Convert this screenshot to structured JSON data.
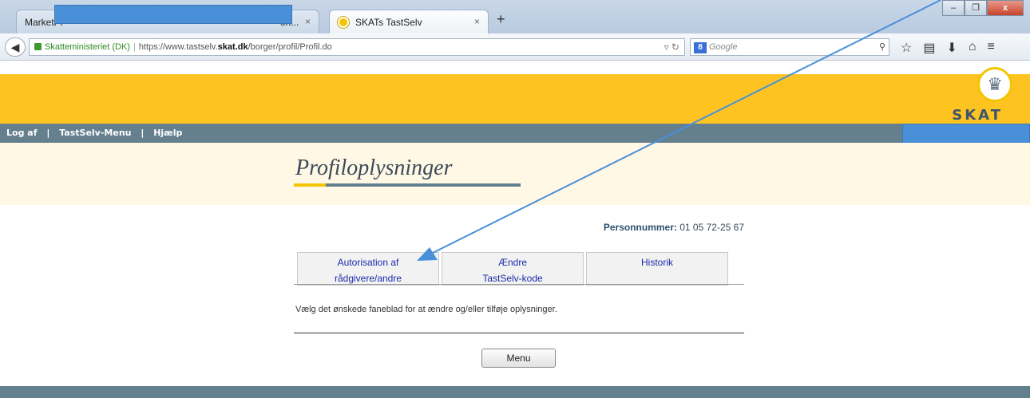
{
  "browser": {
    "tabs": [
      {
        "title_start": "MarketPr",
        "title_end": "on..."
      },
      {
        "title": "SKATs TastSelv"
      }
    ],
    "close_glyph": "×",
    "new_tab_glyph": "+",
    "window_buttons": [
      "–",
      "❐",
      "x"
    ],
    "address": {
      "org": "Skatteministeriet (DK)",
      "url_prefix": "https://www.tastselv.",
      "url_domain": "skat.dk",
      "url_path": "/borger/profil/Profil.do"
    },
    "search_placeholder": "Google",
    "search_engine_glyph": "8"
  },
  "site": {
    "brand": "SKAT",
    "nav": [
      "Log af",
      "TastSelv-Menu",
      "Hjælp"
    ],
    "nav_separator": "|",
    "page_title": "Profiloplysninger",
    "cpr_label": "Personnummer:",
    "cpr_value": "01 05 72-25 67",
    "tabs": [
      {
        "line1": "Autorisation af",
        "line2": "rådgivere/andre"
      },
      {
        "line1": "Ændre",
        "line2": "TastSelv-kode"
      },
      {
        "line1": "Historik",
        "line2": ""
      }
    ],
    "hint": "Vælg det ønskede faneblad for at ændre og/eller tilføje oplysninger.",
    "menu_button": "Menu"
  },
  "colors": {
    "banner": "#fdc321",
    "menubar": "#64808f",
    "tab_link": "#1c2aa8",
    "annotation_arrow": "#4a90d9"
  }
}
